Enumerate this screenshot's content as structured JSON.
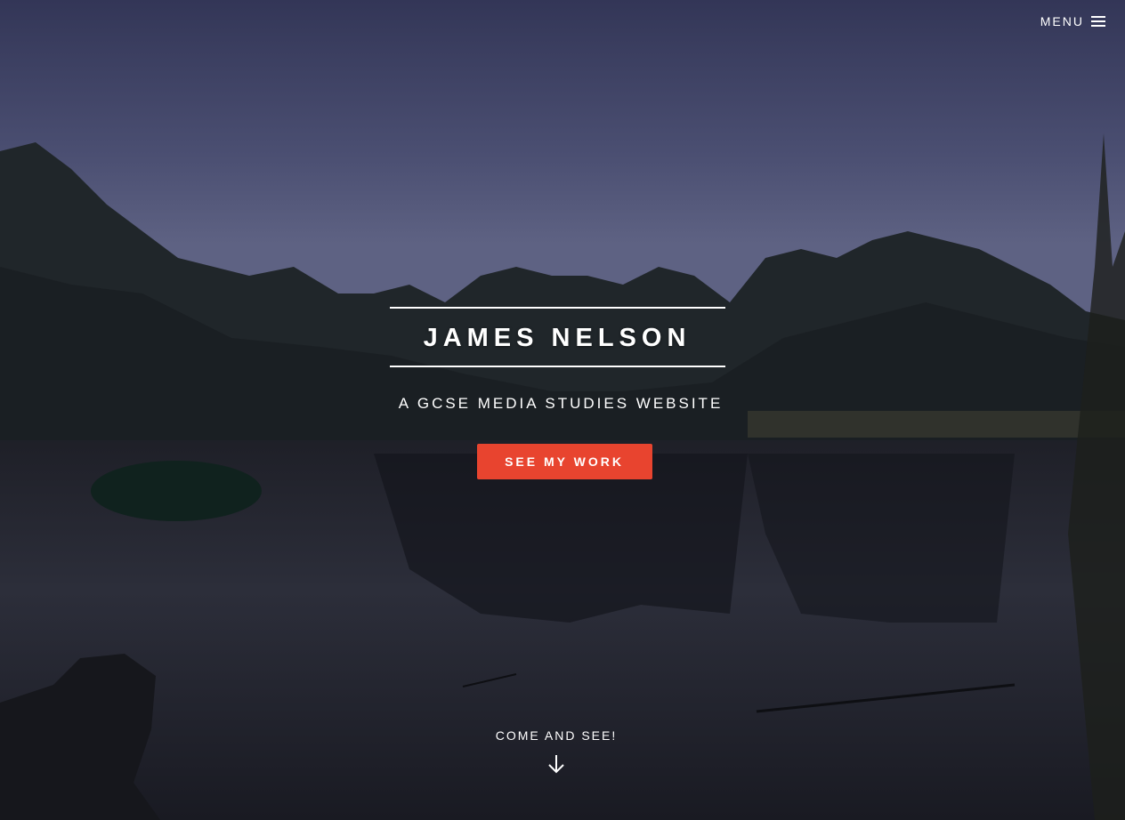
{
  "nav": {
    "menu_label": "MENU",
    "menu_icon": "hamburger-icon"
  },
  "hero": {
    "title": "JAMES NELSON",
    "subtitle": "A GCSE MEDIA STUDIES WEBSITE",
    "cta_label": "SEE MY WORK",
    "scroll_label": "COME AND SEE!",
    "scroll_icon": "arrow-down-icon"
  },
  "colors": {
    "accent": "#e8442f",
    "text": "#ffffff"
  }
}
